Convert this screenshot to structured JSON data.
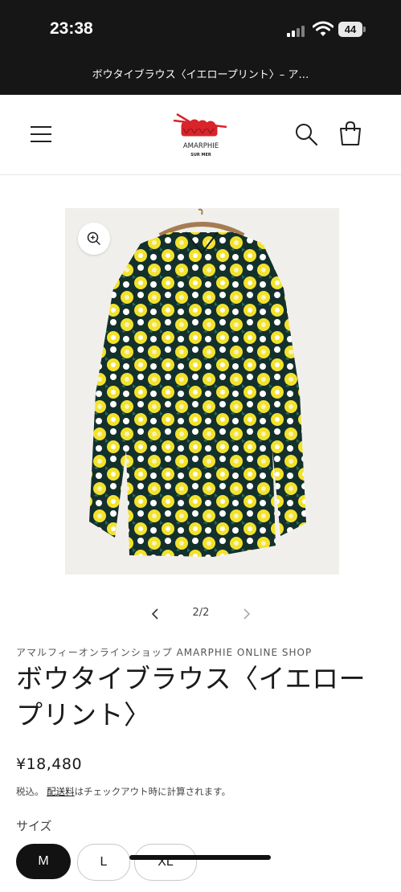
{
  "status_bar": {
    "time": "23:38",
    "battery": "44",
    "signal_icon": "signal-bars-icon",
    "wifi_icon": "wifi-icon"
  },
  "browser": {
    "page_title": "ボウタイブラウス〈イエロープリント〉– ア…"
  },
  "header": {
    "menu_icon": "hamburger-menu-icon",
    "logo_text": "AMARPHIE",
    "logo_subtext": "SUR MER",
    "search_icon": "search-icon",
    "cart_icon": "cart-bag-icon"
  },
  "gallery": {
    "zoom_icon": "zoom-in-icon",
    "counter": "2/2",
    "prev_icon": "chevron-left-icon",
    "next_icon": "chevron-right-icon"
  },
  "product": {
    "vendor": "アマルフィーオンラインショップ AMARPHIE ONLINE SHOP",
    "title": "ボウタイブラウス〈イエロープリント〉",
    "price": "¥18,480",
    "tax_prefix": "税込。",
    "shipping_link": "配送料",
    "tax_suffix": "はチェックアウト時に計算されます。",
    "size_label": "サイズ",
    "sizes": [
      "M",
      "L",
      "XL"
    ],
    "selected_size": "M"
  },
  "colors": {
    "accent": "#d8242b",
    "status_bg": "#161616",
    "print_yellow": "#f2e22c",
    "print_dark": "#14302c"
  }
}
